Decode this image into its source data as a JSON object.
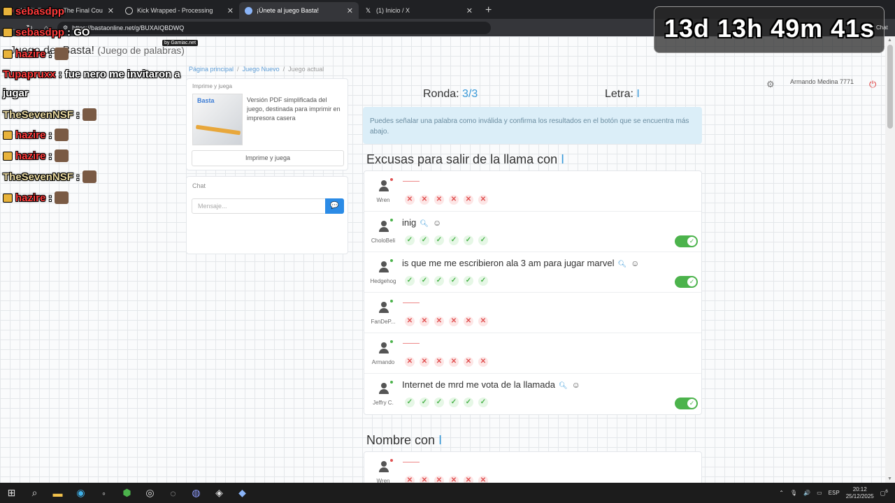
{
  "browser": {
    "tabs": [
      {
        "title": "(1218) Europe - The Final Cou",
        "icon": "youtube-icon",
        "active": false
      },
      {
        "title": "Kick Wrapped - Processing",
        "icon": "globe-icon",
        "active": false
      },
      {
        "title": "¡Únete al juego Basta!",
        "icon": "globe-icon",
        "active": true
      },
      {
        "title": "(1) Inicio / X",
        "icon": "x-icon",
        "active": false
      }
    ],
    "url": "https://bastaonline.net/g/BUXAIQBDWQ"
  },
  "site": {
    "title": "Juego de ¡Basta!",
    "subtitle": "(Juego de palabras)",
    "gamiac": "by Gamiac.net"
  },
  "breadcrumb": {
    "home": "Página principal",
    "new_game": "Juego Nuevo",
    "current": "Juego actual"
  },
  "print_card": {
    "title": "Imprime y juega",
    "logo": "Basta",
    "description": "Versión PDF simplificada del juego, destinada para imprimir en impresora casera",
    "button": "Imprime y juega"
  },
  "chat_card": {
    "title": "Chat",
    "placeholder": "Mensaje..."
  },
  "game": {
    "round_label": "Ronda:",
    "round_value": "3/3",
    "letter_label": "Letra:",
    "letter_value": "I",
    "info": "Puedes señalar una palabra como inválida y confirma los resultados en el botón que se encuentra más abajo."
  },
  "categories": [
    {
      "title": "Excusas para salir de la llama con",
      "letter": "I",
      "entries": [
        {
          "user": "Wren",
          "word": "",
          "valid": false,
          "status_color": "#e05252"
        },
        {
          "user": "CholoBeli",
          "word": "inig",
          "valid": true,
          "status_color": "#4cb34c"
        },
        {
          "user": "Hedgehog",
          "word": "is que me me escribieron ala 3 am para jugar marvel",
          "valid": true,
          "status_color": "#4cb34c"
        },
        {
          "user": "FanDeP...",
          "word": "",
          "valid": false,
          "status_color": "#4cb34c"
        },
        {
          "user": "Armando",
          "word": "",
          "valid": false,
          "status_color": "#4cb34c"
        },
        {
          "user": "Jeffry C.",
          "word": "Internet de mrd me vota de la llamada",
          "valid": true,
          "status_color": "#4cb34c"
        }
      ]
    },
    {
      "title": "Nombre con",
      "letter": "I",
      "entries": [
        {
          "user": "Wren",
          "word": "",
          "valid": false,
          "status_color": "#e05252"
        }
      ]
    }
  ],
  "overlay": {
    "timer": "13d 13h 49m 41s",
    "user_name": "Armando Medina 7771",
    "chat_label": "Chat",
    "chat_lines": [
      {
        "name": "sebasdpp",
        "msg": "",
        "color": "#ff3b3b"
      },
      {
        "name": "sebasdpp",
        "msg": ": GO",
        "color": "#ff3b3b"
      },
      {
        "name": "hazire",
        "msg": ":",
        "color": "#ff3b3b"
      },
      {
        "name": "Tupapruxx",
        "msg": ": fue nero me invitaron a",
        "color": "#ff3b3b"
      },
      {
        "name": "jugar",
        "msg": "",
        "color": "#ffffff"
      },
      {
        "name": "TheSevenNSF",
        "msg": ":",
        "color": "#e8d8a0"
      },
      {
        "name": "hazire",
        "msg": ":",
        "color": "#ff3b3b"
      },
      {
        "name": "hazire",
        "msg": ":",
        "color": "#ff3b3b"
      },
      {
        "name": "TheSevenNSF",
        "msg": ":",
        "color": "#e8d8a0"
      },
      {
        "name": "hazire",
        "msg": ":",
        "color": "#ff3b3b"
      }
    ]
  },
  "taskbar": {
    "lang": "ESP",
    "time": "20:12",
    "date": "25/12/2025",
    "notif": "6"
  }
}
